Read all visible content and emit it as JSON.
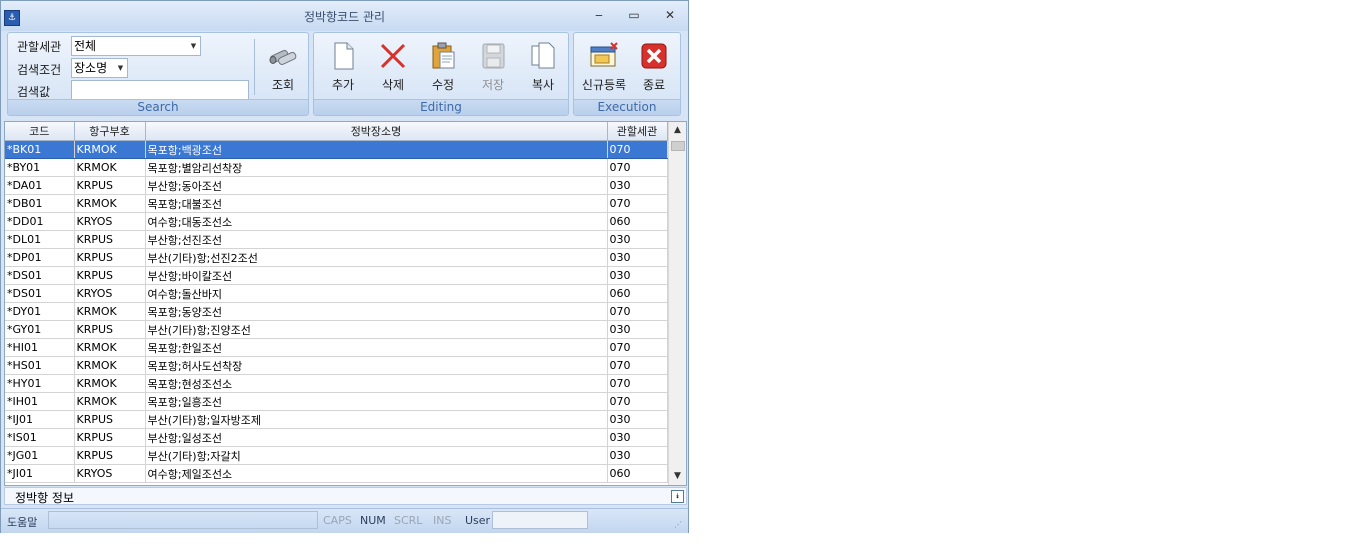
{
  "window": {
    "title": "정박항코드 관리"
  },
  "search": {
    "office_label": "관할세관",
    "office_value": "전체",
    "cond_label": "검색조건",
    "cond_value": "장소명",
    "value_label": "검색값",
    "value_value": "",
    "query_label": "조회",
    "group_label": "Search"
  },
  "editing": {
    "add": "추가",
    "delete": "삭제",
    "edit": "수정",
    "save": "저장",
    "copy": "복사",
    "group_label": "Editing"
  },
  "execution": {
    "new": "신규등록",
    "exit": "종료",
    "group_label": "Execution"
  },
  "grid": {
    "columns": [
      "코드",
      "항구부호",
      "정박장소명",
      "관할세관"
    ],
    "rows": [
      [
        "*BK01",
        "KRMOK",
        "목포항;백광조선",
        "070"
      ],
      [
        "*BY01",
        "KRMOK",
        "목포항;별암리선착장",
        "070"
      ],
      [
        "*DA01",
        "KRPUS",
        "부산항;동아조선",
        "030"
      ],
      [
        "*DB01",
        "KRMOK",
        "목포항;대불조선",
        "070"
      ],
      [
        "*DD01",
        "KRYOS",
        "여수항;대동조선소",
        "060"
      ],
      [
        "*DL01",
        "KRPUS",
        "부산항;선진조선",
        "030"
      ],
      [
        "*DP01",
        "KRPUS",
        "부산(기타)항;선진2조선",
        "030"
      ],
      [
        "*DS01",
        "KRPUS",
        "부산항;바이칼조선",
        "030"
      ],
      [
        "*DS01",
        "KRYOS",
        "여수항;돌산바지",
        "060"
      ],
      [
        "*DY01",
        "KRMOK",
        "목포항;동양조선",
        "070"
      ],
      [
        "*GY01",
        "KRPUS",
        "부산(기타)항;진양조선",
        "030"
      ],
      [
        "*HI01",
        "KRMOK",
        "목포항;한일조선",
        "070"
      ],
      [
        "*HS01",
        "KRMOK",
        "목포항;허사도선착장",
        "070"
      ],
      [
        "*HY01",
        "KRMOK",
        "목포항;현성조선소",
        "070"
      ],
      [
        "*IH01",
        "KRMOK",
        "목포항;일흥조선",
        "070"
      ],
      [
        "*IJ01",
        "KRPUS",
        "부산(기타)항;일자방조제",
        "030"
      ],
      [
        "*IS01",
        "KRPUS",
        "부산항;일성조선",
        "030"
      ],
      [
        "*JG01",
        "KRPUS",
        "부산(기타)항;자갈치",
        "030"
      ],
      [
        "*JI01",
        "KRYOS",
        "여수항;제일조선소",
        "060"
      ]
    ],
    "selected_row": 0
  },
  "info_panel": {
    "title": "정박항 정보"
  },
  "status": {
    "help": "도움말",
    "caps": "CAPS",
    "num": "NUM",
    "scrl": "SCRL",
    "ins": "INS",
    "user_label": "User",
    "user_value": ""
  },
  "colors": {
    "selection": "#3b78d4",
    "accent": "#3e6aa6",
    "delete_red": "#d6312b"
  }
}
